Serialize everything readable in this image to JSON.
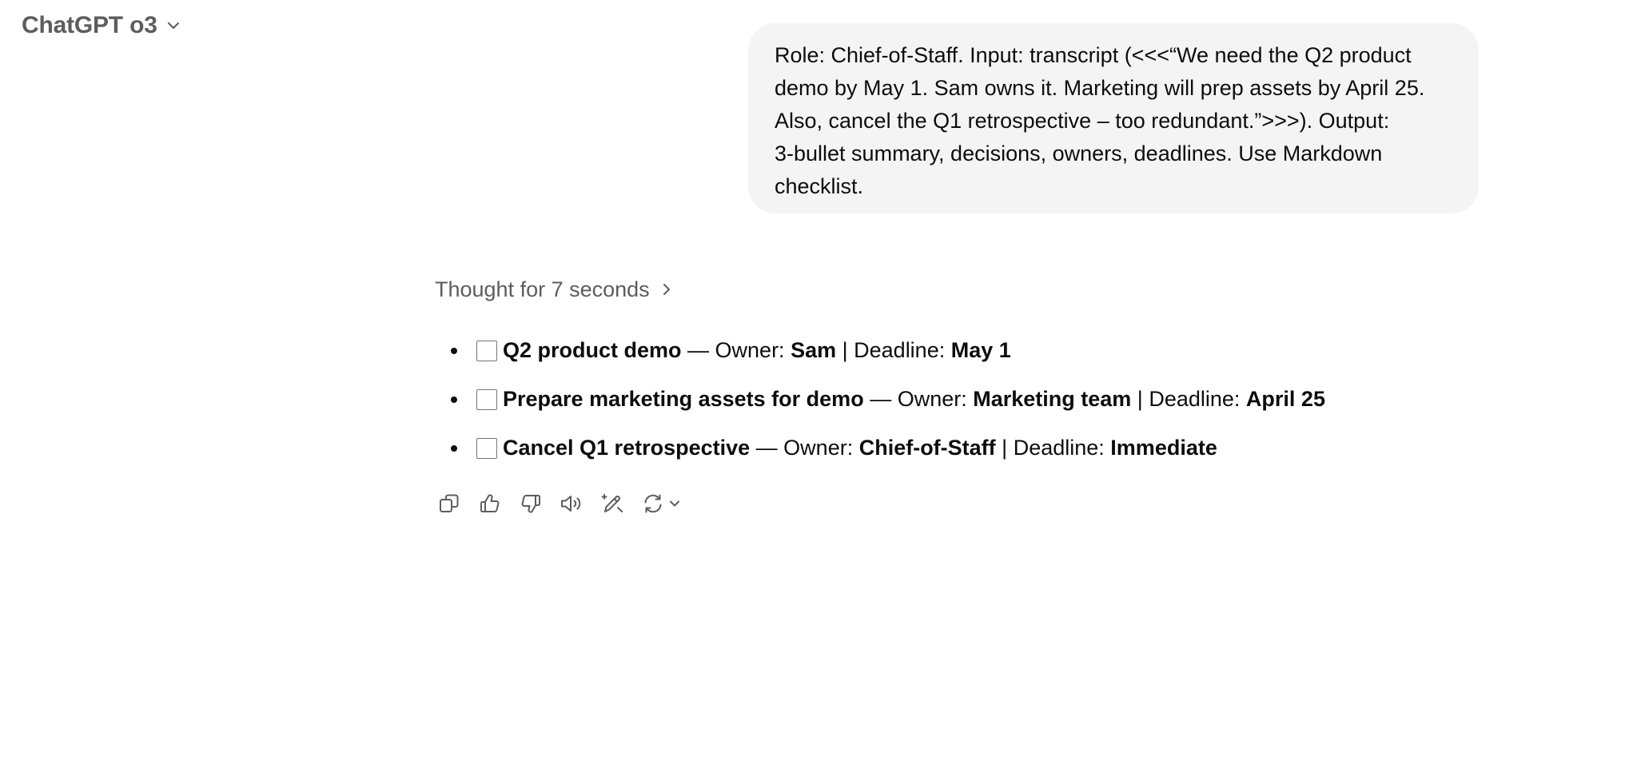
{
  "header": {
    "model_name": "ChatGPT o3",
    "chevron_icon": "chevron-down-icon"
  },
  "user_message": {
    "lines": [
      "Role: Chief-of-Staff. Input: transcript (<<<“We need the Q2 product",
      "demo by May 1. Sam owns it. Marketing will prep assets by April 25.",
      "Also, cancel the Q1 retrospective – too redundant.”>>>). Output:",
      "3-bullet summary, decisions, owners, deadlines. Use Markdown",
      "checklist."
    ]
  },
  "assistant": {
    "thought_label": "Thought for 7 seconds",
    "checklist": [
      {
        "task": "Q2 product demo",
        "separator": " — ",
        "owner_label": "Owner: ",
        "owner": "Sam",
        "divider": " | ",
        "deadline_label": "Deadline: ",
        "deadline": "May 1",
        "checked": false
      },
      {
        "task": "Prepare marketing assets for demo",
        "separator": " — ",
        "owner_label": "Owner: ",
        "owner": "Marketing team",
        "divider": " | ",
        "deadline_label": "Deadline: ",
        "deadline": "April 25",
        "checked": false
      },
      {
        "task": "Cancel Q1 retrospective",
        "separator": " — ",
        "owner_label": "Owner: ",
        "owner": "Chief-of-Staff",
        "divider": " | ",
        "deadline_label": "Deadline: ",
        "deadline": "Immediate",
        "checked": false
      }
    ]
  },
  "actions": [
    "copy-icon",
    "thumbs-up-icon",
    "thumbs-down-icon",
    "read-aloud-icon",
    "edit-icon",
    "regenerate-icon"
  ],
  "colors": {
    "title_gray": "#5d5d5d",
    "bubble_bg": "#f4f4f4",
    "text": "#0d0d0d",
    "icon": "#5d5d5d"
  }
}
